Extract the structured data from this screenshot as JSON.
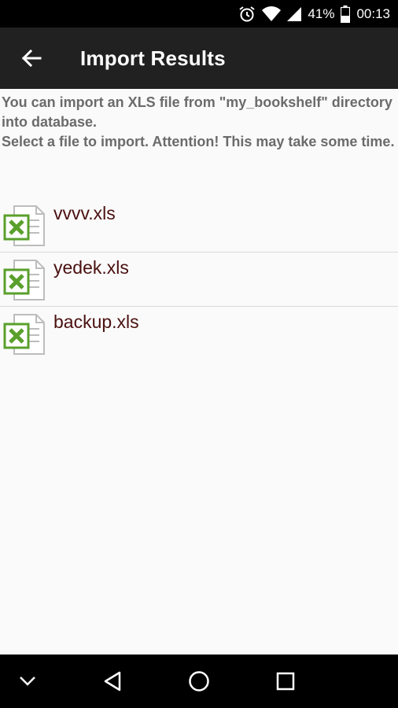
{
  "status_bar": {
    "battery_percent": "41%",
    "time": "00:13",
    "icons": [
      "alarm-icon",
      "wifi-icon",
      "signal-icon",
      "battery-icon"
    ]
  },
  "app_bar": {
    "title": "Import Results",
    "back_icon": "back-arrow-icon"
  },
  "instructions": "You can import an XLS file from \"my_bookshelf\" directory into database.\n Select a file to import. Attention! This may take some time.",
  "files": [
    {
      "name": "vvvv.xls",
      "icon": "excel-file-icon"
    },
    {
      "name": "yedek.xls",
      "icon": "excel-file-icon"
    },
    {
      "name": "backup.xls",
      "icon": "excel-file-icon"
    }
  ],
  "nav_bar": {
    "icons": [
      "chevron-down-icon",
      "back-triangle-icon",
      "home-circle-icon",
      "recents-square-icon"
    ]
  },
  "colors": {
    "app_bar": "#212121",
    "background": "#fafafa",
    "file_name": "#4a1010",
    "excel_green": "#5aa02c"
  }
}
